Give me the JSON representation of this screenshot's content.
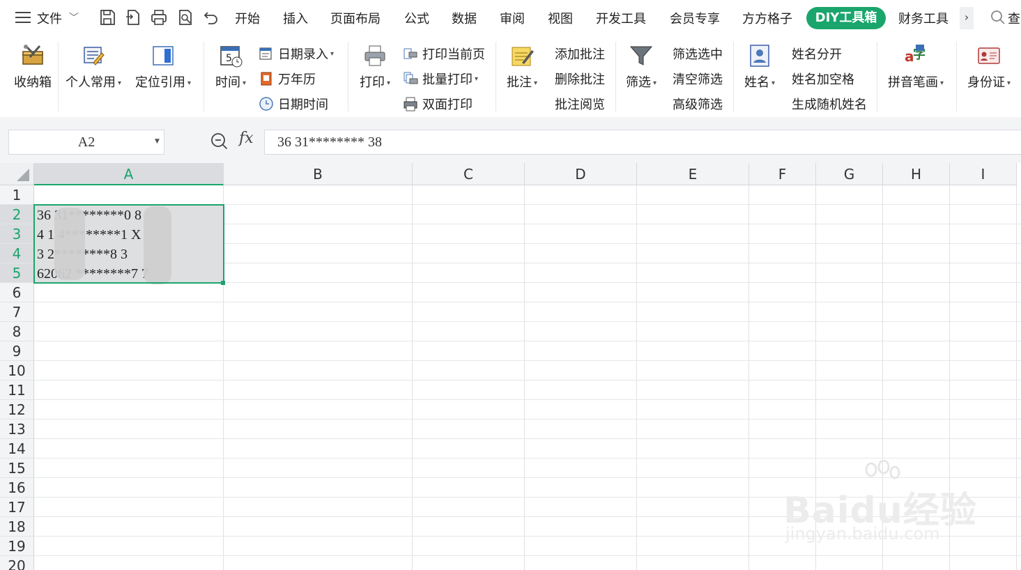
{
  "menubar": {
    "file_label": "文件",
    "tabs": [
      "开始",
      "插入",
      "页面布局",
      "公式",
      "数据",
      "审阅",
      "视图",
      "开发工具",
      "会员专享",
      "方方格子"
    ],
    "active_tab": "DIY工具箱",
    "after_tabs": [
      "财务工具"
    ],
    "more": "›",
    "search_label": "查"
  },
  "ribbon": {
    "toolbox": "收纳箱",
    "personal": "个人常用",
    "locate_ref": "定位引用",
    "time": "时间",
    "date_entry": "日期录入",
    "calendar": "万年历",
    "datetime": "日期时间",
    "print": "打印",
    "print_current": "打印当前页",
    "batch_print": "批量打印",
    "duplex_print": "双面打印",
    "comment": "批注",
    "add_comment": "添加批注",
    "delete_comment": "删除批注",
    "view_comment": "批注阅览",
    "filter": "筛选",
    "filter_selected": "筛选选中",
    "clear_filter": "清空筛选",
    "advanced_filter": "高级筛选",
    "name": "姓名",
    "split_name": "姓名分开",
    "name_spaces": "姓名加空格",
    "random_name": "生成随机姓名",
    "pinyin": "拼音笔画",
    "id_card": "身份证"
  },
  "formula_bar": {
    "name_box": "A2",
    "fx": "fx",
    "value": "36  31********  38"
  },
  "sheet": {
    "columns": [
      "A",
      "B",
      "C",
      "D",
      "E",
      "F",
      "G",
      "H",
      "I"
    ],
    "selected_column": "A",
    "rows": [
      "1",
      "2",
      "3",
      "4",
      "5",
      "6",
      "7",
      "8",
      "9",
      "10",
      "11",
      "12",
      "13",
      "14",
      "15",
      "16",
      "17",
      "18",
      "19",
      "20"
    ],
    "selected_rows": [
      "2",
      "3",
      "4",
      "5"
    ],
    "cells_A": [
      "",
      "36  31********0  8",
      "4  1  4********1  X",
      "3    2********8  3",
      "62062  ********7  7"
    ]
  },
  "watermark": {
    "brand": "Baidu经验",
    "url": "jingyan.baidu.com"
  },
  "colors": {
    "accent": "#1aa56c",
    "selection_fill": "#dedfe1",
    "header_bg": "#f3f4f6"
  }
}
